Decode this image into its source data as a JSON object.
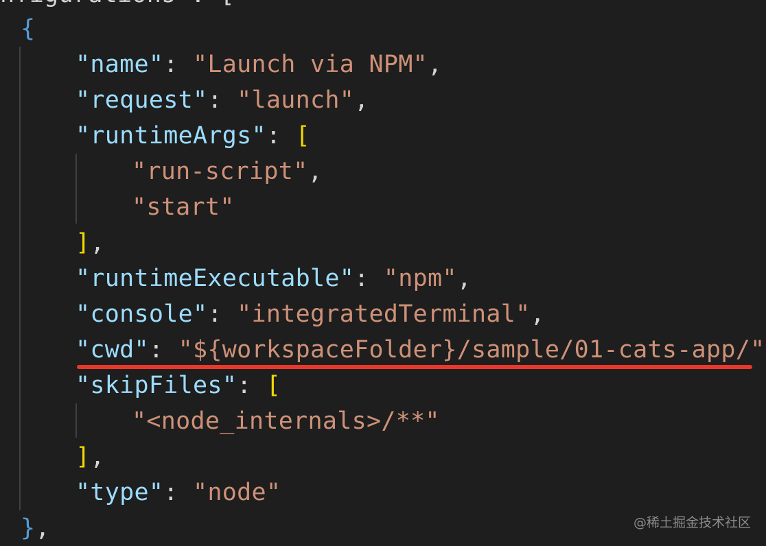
{
  "colors": {
    "background": "#1e1e1e",
    "key": "#9cdcfe",
    "string": "#ce9178",
    "punctuation": "#d4d4d4",
    "brace": "#569cd6",
    "bracket": "#f1d700",
    "indent_guide": "#404040",
    "highlight_underline": "#e8382b",
    "watermark": "#8c8c8c"
  },
  "code": {
    "partial_top": {
      "text": "nfigurations\": ["
    },
    "open_brace": "{",
    "name": {
      "key": "\"name\"",
      "sep": ": ",
      "value": "\"Launch via NPM\"",
      "comma": ","
    },
    "request": {
      "key": "\"request\"",
      "sep": ": ",
      "value": "\"launch\"",
      "comma": ","
    },
    "runtimeArgs": {
      "key": "\"runtimeArgs\"",
      "sep": ": ",
      "open": "[",
      "items": [
        {
          "value": "\"run-script\"",
          "comma": ","
        },
        {
          "value": "\"start\"",
          "comma": ""
        }
      ],
      "close": "]",
      "comma": ","
    },
    "runtimeExecutable": {
      "key": "\"runtimeExecutable\"",
      "sep": ": ",
      "value": "\"npm\"",
      "comma": ","
    },
    "console": {
      "key": "\"console\"",
      "sep": ": ",
      "value": "\"integratedTerminal\"",
      "comma": ","
    },
    "cwd": {
      "key": "\"cwd\"",
      "sep": ": ",
      "value": "\"${workspaceFolder}/sample/01-cats-app/\"",
      "comma": ","
    },
    "skipFiles": {
      "key": "\"skipFiles\"",
      "sep": ": ",
      "open": "[",
      "items": [
        {
          "value": "\"<node_internals>/**\"",
          "comma": ""
        }
      ],
      "close": "]",
      "comma": ","
    },
    "type": {
      "key": "\"type\"",
      "sep": ": ",
      "value": "\"node\"",
      "comma": ""
    },
    "close_brace": "}",
    "close_brace_comma": ","
  },
  "watermark": "@稀土掘金技术社区"
}
